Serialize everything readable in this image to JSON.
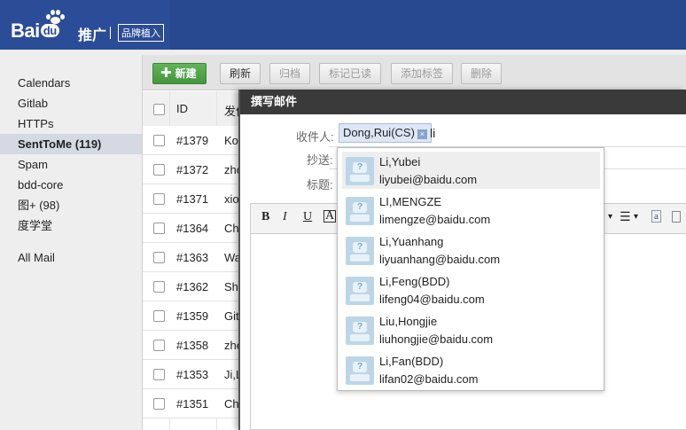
{
  "header": {
    "logo_text": "Bai",
    "logo_du": "du",
    "product": "推广",
    "badge": "品牌植入"
  },
  "sidebar": {
    "items": [
      {
        "label": "Calendars"
      },
      {
        "label": "Gitlab"
      },
      {
        "label": "HTTPs"
      },
      {
        "label": "SentToMe (119)",
        "active": true
      },
      {
        "label": "Spam"
      },
      {
        "label": "bdd-core"
      },
      {
        "label": "图+ (98)"
      },
      {
        "label": "度学堂"
      },
      {
        "label": "All Mail"
      }
    ]
  },
  "toolbar": {
    "new_label": "新建",
    "refresh_label": "刷新",
    "archive_label": "归档",
    "mark_read_label": "标记已读",
    "add_tag_label": "添加标签",
    "delete_label": "删除"
  },
  "table": {
    "headers": {
      "id": "ID",
      "from": "发件"
    },
    "rows": [
      {
        "id": "#1379",
        "from": "Ko"
      },
      {
        "id": "#1372",
        "from": "zho"
      },
      {
        "id": "#1371",
        "from": "xio"
      },
      {
        "id": "#1364",
        "from": "Ch"
      },
      {
        "id": "#1363",
        "from": "Wa"
      },
      {
        "id": "#1362",
        "from": "Sha"
      },
      {
        "id": "#1359",
        "from": "Git"
      },
      {
        "id": "#1358",
        "from": "zhe"
      },
      {
        "id": "#1353",
        "from": "Ji,L"
      },
      {
        "id": "#1351",
        "from": "Ch"
      }
    ]
  },
  "compose": {
    "title": "撰写邮件",
    "to_label": "收件人:",
    "cc_label": "抄送:",
    "subject_label": "标题:",
    "recipient_chip": "Dong,Rui(CS)",
    "chip_remove": "×",
    "typed_query": "li"
  },
  "editor": {
    "bold": "B",
    "italic": "I",
    "underline": "U",
    "font_a": "A"
  },
  "suggestions": [
    {
      "name": "Li,Yubei",
      "email": "liyubei@baidu.com",
      "highlight": true
    },
    {
      "name": "LI,MENGZE",
      "email": "limengze@baidu.com"
    },
    {
      "name": "Li,Yuanhang",
      "email": "liyuanhang@baidu.com"
    },
    {
      "name": "Li,Feng(BDD)",
      "email": "lifeng04@baidu.com"
    },
    {
      "name": "Liu,Hongjie",
      "email": "liuhongjie@baidu.com"
    },
    {
      "name": "Li,Fan(BDD)",
      "email": "lifan02@baidu.com"
    }
  ],
  "colors": {
    "header_bg": "#28488f",
    "primary_button": "#45963d",
    "sidebar_active": "#d4d9e4",
    "dialog_title_bg": "#3a3a3a",
    "chip_bg": "#dde7f6"
  },
  "icons": [
    "baidu-paw-logo",
    "plus-icon",
    "avatar-placeholder-icon",
    "chip-remove-icon"
  ]
}
